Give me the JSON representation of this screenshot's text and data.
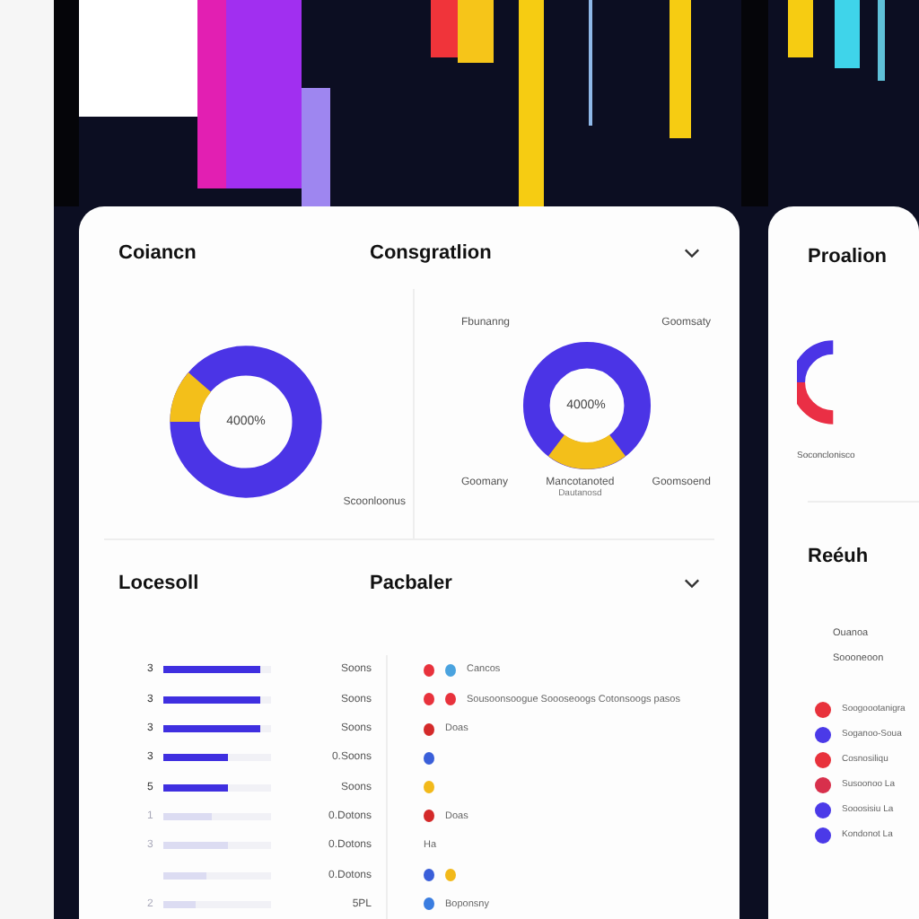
{
  "main_card": {
    "top_section": {
      "title": "Coiancn",
      "subtitle": "Consgratlion",
      "left_donut": {
        "center": "4000%",
        "label": "Scoonloonus"
      },
      "right_donut": {
        "top_labels": [
          "Fbunanng",
          "Goomsaty"
        ],
        "center": "4000%",
        "bottom_labels": [
          "Goomany",
          "Mancotanoted",
          "Goomsoend"
        ],
        "bottom_note": "Dautanosd"
      }
    },
    "bottom_section": {
      "title": "Locesoll",
      "subtitle": "Pacbaler",
      "bars": [
        {
          "label": "3",
          "level": 0.9,
          "value": "Soons",
          "faded": false
        },
        {
          "label": "3",
          "level": 0.9,
          "value": "Soons",
          "faded": false
        },
        {
          "label": "3",
          "level": 0.9,
          "value": "Soons",
          "faded": false
        },
        {
          "label": "3",
          "level": 0.6,
          "value": "0.Soons",
          "faded": false
        },
        {
          "label": "5",
          "level": 0.6,
          "value": "Soons",
          "faded": false
        },
        {
          "label": "1",
          "level": 0.45,
          "value": "0.Dotons",
          "faded": true
        },
        {
          "label": "3",
          "level": 0.6,
          "value": "0.Dotons",
          "faded": true
        },
        {
          "level": 0.4,
          "value": "0.Dotons",
          "faded": true
        },
        {
          "label": "2",
          "level": 0.3,
          "value": "5PL",
          "faded": true
        }
      ],
      "events": [
        {
          "dots": [
            {
              "color": "#e8323c"
            },
            {
              "color": "#4aa3df"
            }
          ],
          "text": "Cancos"
        },
        {
          "dots": [
            {
              "color": "#e8323c"
            },
            {
              "color": "#e8323c"
            }
          ],
          "text": "Sousoonsoogue Soooseoogs Cotonsoogs pasos"
        },
        {
          "dots": [
            {
              "color": "#d42a2a"
            }
          ],
          "text": "Doas"
        },
        {
          "dots": [
            {
              "color": "#3a5fd9"
            }
          ]
        },
        {
          "dots": [
            {
              "color": "#f2b91a"
            }
          ]
        },
        {
          "dots": [
            {
              "color": "#d42a2a"
            }
          ],
          "text": "Doas"
        },
        {
          "text": "Ha"
        },
        {
          "dots": [
            {
              "color": "#3a5fd9"
            },
            {
              "color": "#f2b91a"
            }
          ]
        },
        {
          "dots": [
            {
              "color": "#3a7de0"
            }
          ],
          "text": "Boponsny"
        }
      ]
    }
  },
  "side_card": {
    "title": "Proalion",
    "donut_label": "Soconclonisco",
    "section_title": "Reéuh",
    "list_heading": [
      "Ouanoa",
      "Soooneoon"
    ],
    "items": [
      {
        "color": "#e8323c",
        "text": "Soogoootanigra"
      },
      {
        "color": "#4b3ae8",
        "text": "Soganoo-Soua"
      },
      {
        "color": "#e8323c",
        "text": "Cosnosiliqu"
      },
      {
        "color": "#d8304c",
        "text": "Susoonoo La"
      },
      {
        "color": "#4b3ae8",
        "text": "Sooosisiu La"
      },
      {
        "color": "#4b3ae8",
        "text": "Kondonot La"
      }
    ]
  }
}
